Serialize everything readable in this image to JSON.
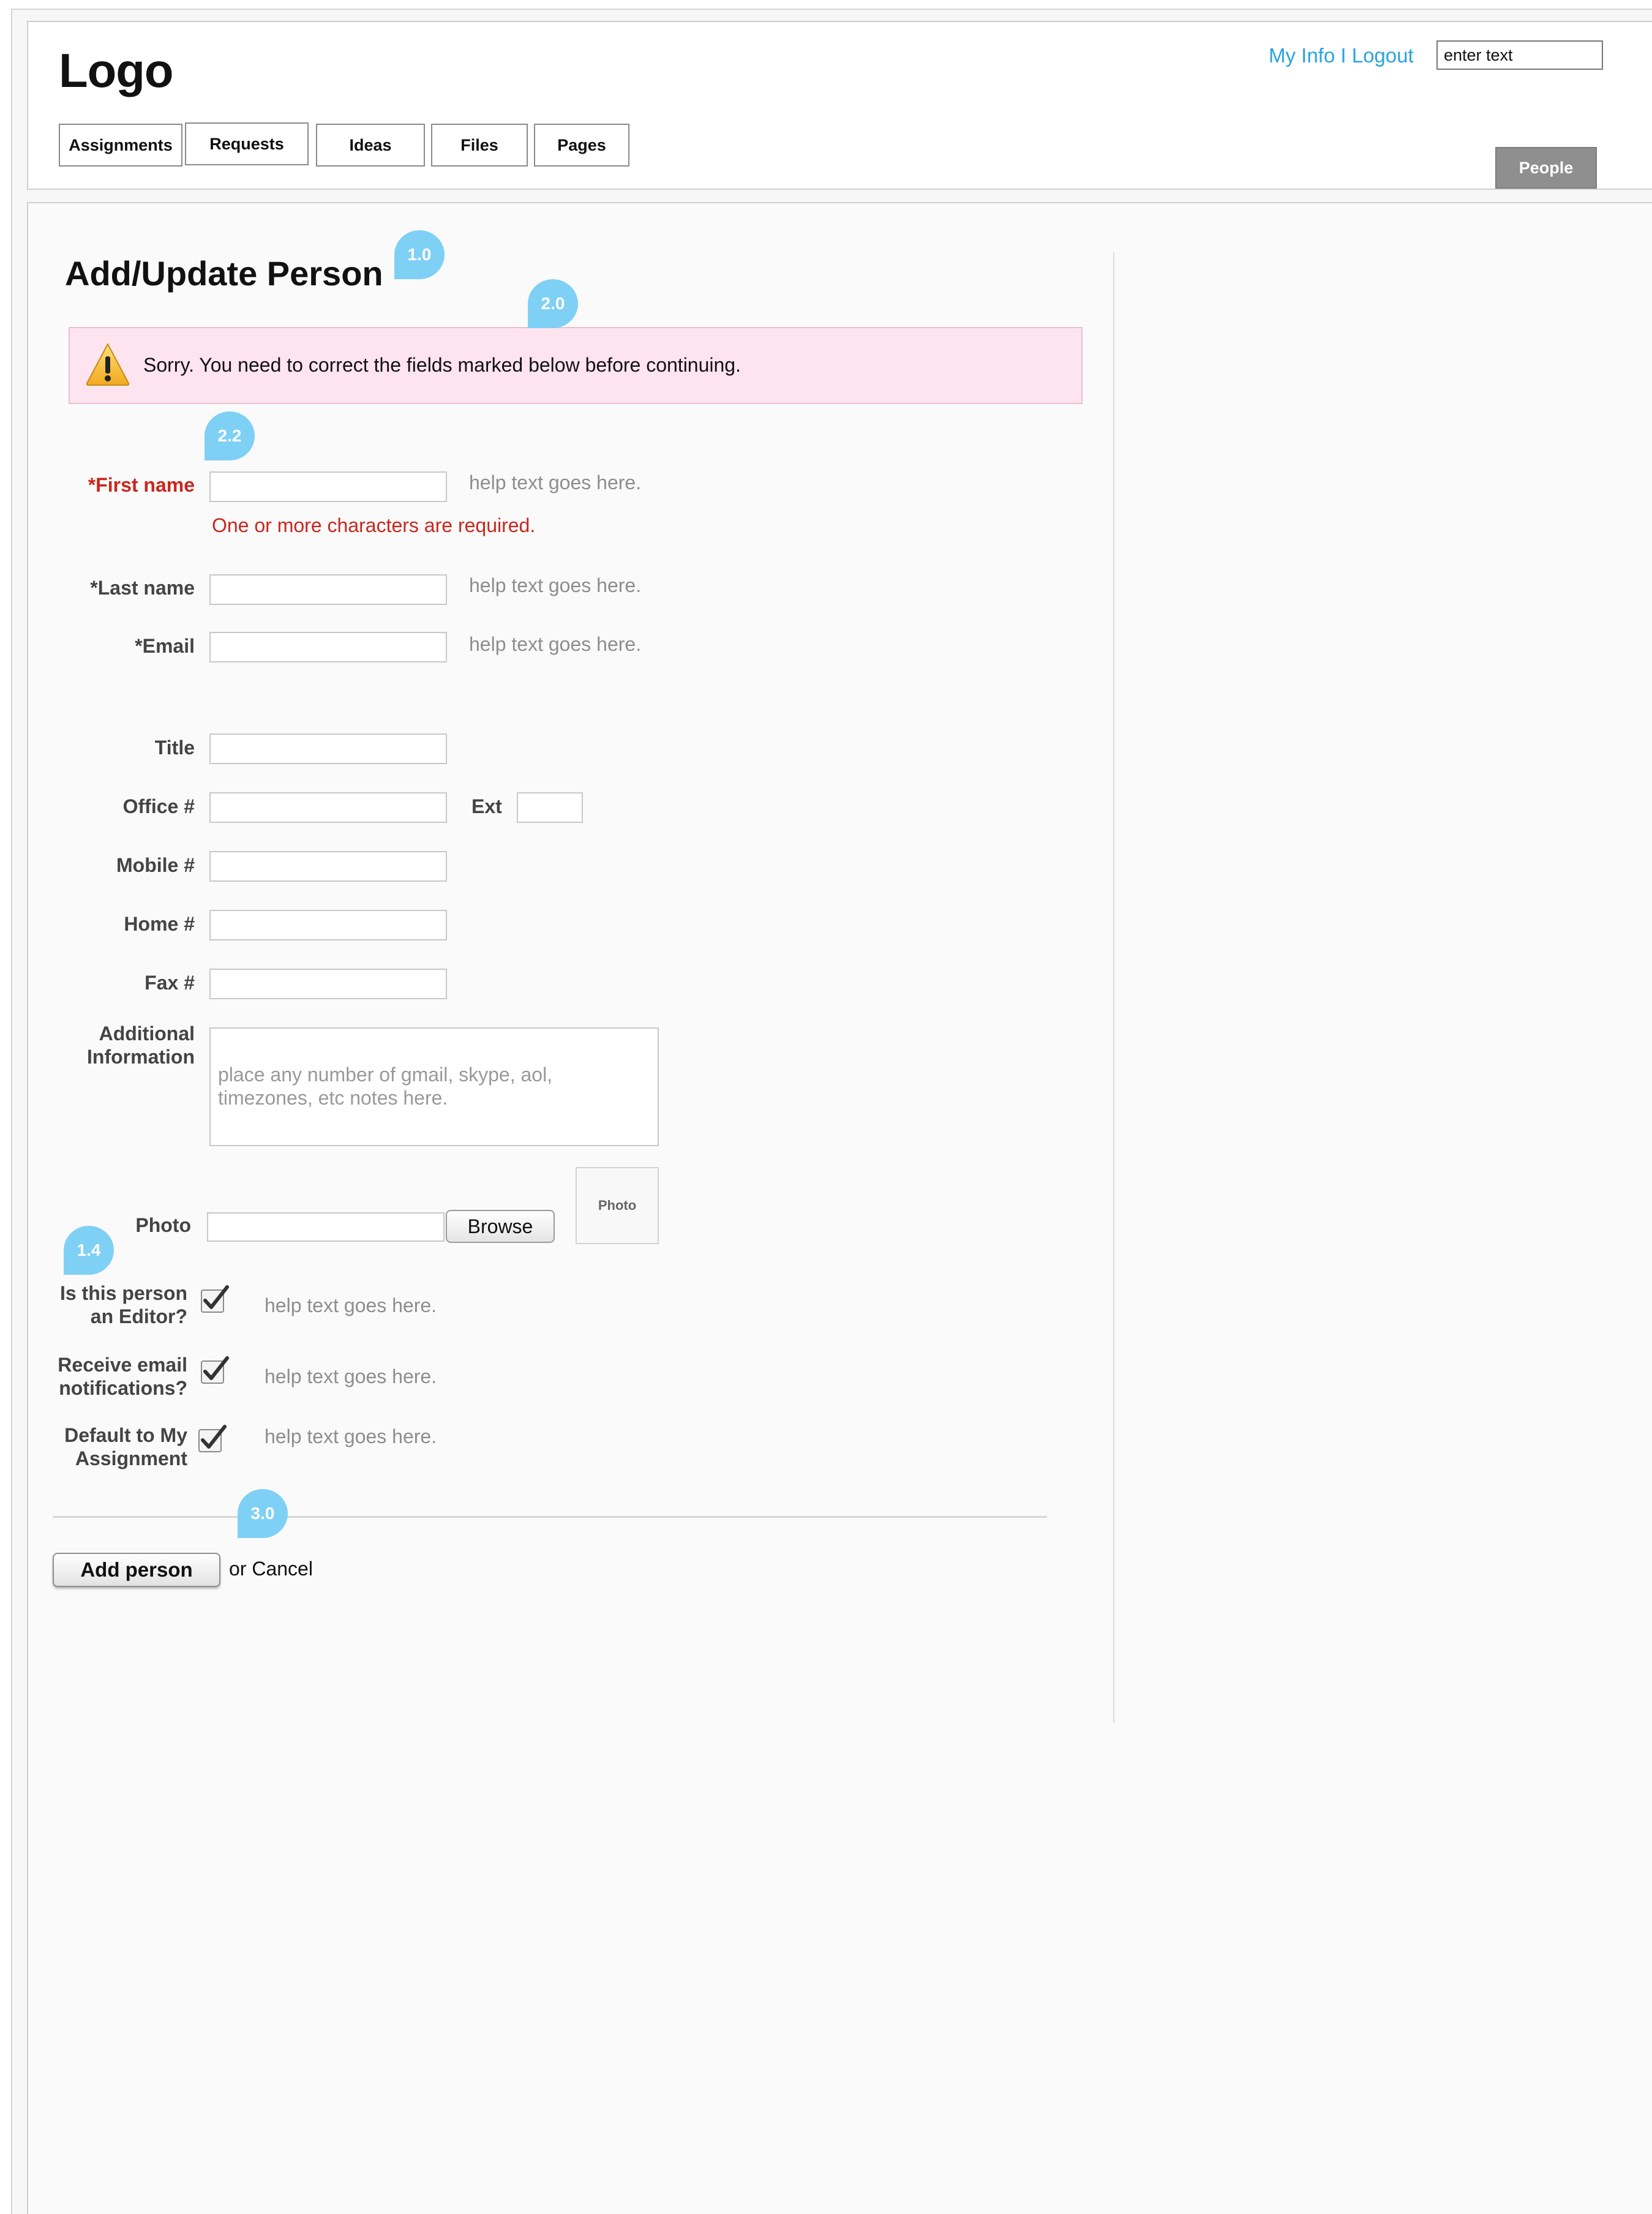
{
  "header": {
    "logo": "Logo",
    "links": {
      "my_info": "My Info",
      "separator": " I ",
      "logout": "Logout"
    },
    "search_value": "enter text",
    "tabs": [
      "Assignments",
      "Requests",
      "Ideas",
      "Files",
      "Pages"
    ],
    "people_tab": "People"
  },
  "page": {
    "title": "Add/Update Person",
    "annotations": [
      "1.0",
      "2.0",
      "2.2",
      "1.4",
      "3.0"
    ]
  },
  "error_banner": {
    "icon": "warning-icon",
    "message": "Sorry. You need to correct the fields marked below before continuing."
  },
  "form": {
    "first_name": {
      "label": "*First name",
      "help": "help text goes here.",
      "error": "One or more characters are required."
    },
    "last_name": {
      "label": "*Last name",
      "help": "help text goes here."
    },
    "email": {
      "label": "*Email",
      "help": "help text goes here."
    },
    "title": {
      "label": "Title"
    },
    "office": {
      "label": "Office #",
      "ext_label": "Ext"
    },
    "mobile": {
      "label": "Mobile #"
    },
    "home": {
      "label": "Home #"
    },
    "fax": {
      "label": "Fax #"
    },
    "additional": {
      "label_line1": "Additional",
      "label_line2": "Information",
      "placeholder": "place any number of gmail, skype, aol, timezones, etc notes here."
    },
    "photo": {
      "label": "Photo",
      "browse": "Browse",
      "preview": "Photo"
    },
    "editor": {
      "label_line1": "Is this person",
      "label_line2": "an Editor?",
      "checked": true,
      "help": "help text goes here."
    },
    "notifications": {
      "label_line1": "Receive email",
      "label_line2": "notifications?",
      "checked": true,
      "help": "help text goes here."
    },
    "default_assignment": {
      "label_line1": "Default to My",
      "label_line2": "Assignment",
      "checked": true,
      "help": "help text goes here."
    }
  },
  "actions": {
    "submit": "Add person",
    "or": "or ",
    "cancel": "Cancel"
  },
  "colors": {
    "link": "#29a3e0",
    "error": "#c8281e",
    "error_bg": "#fde4ef",
    "pin": "#7fd0f5",
    "people_tab_bg": "#8f8f8f"
  }
}
